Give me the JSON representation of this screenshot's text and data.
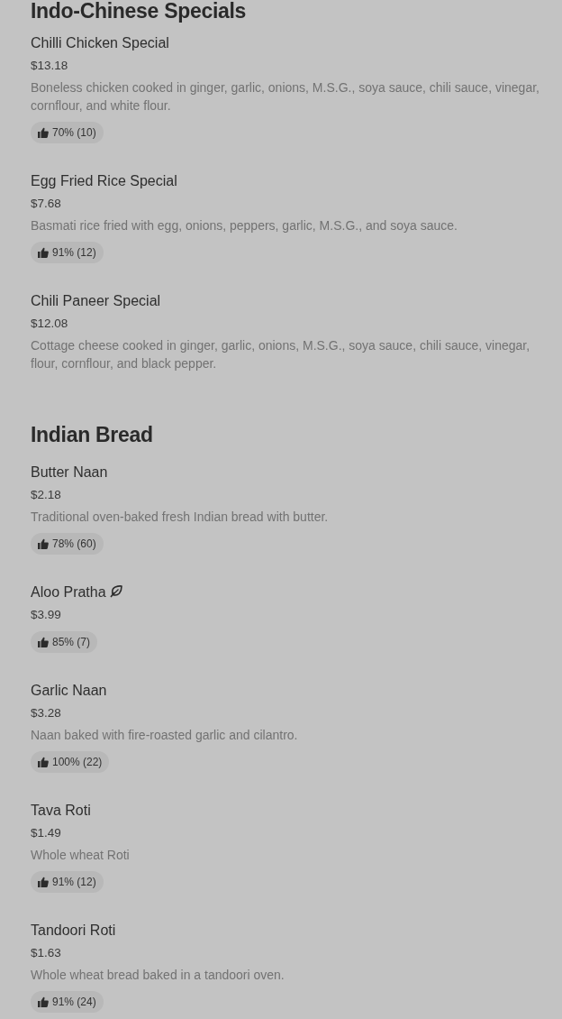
{
  "sections": [
    {
      "title": "Indo-Chinese Specials",
      "items": [
        {
          "name": "Chilli Chicken Special",
          "vegetarian": false,
          "price": "$13.18",
          "description": "Boneless chicken cooked in ginger, garlic, onions, M.S.G., soya sauce, chili sauce, vinegar, cornflour, and white flour.",
          "rating": "70% (10)"
        },
        {
          "name": "Egg Fried Rice Special",
          "vegetarian": false,
          "price": "$7.68",
          "description": "Basmati rice fried with egg, onions, peppers, garlic, M.S.G., and soya sauce.",
          "rating": "91% (12)"
        },
        {
          "name": "Chili Paneer Special",
          "vegetarian": false,
          "price": "$12.08",
          "description": "Cottage cheese cooked in ginger, garlic, onions, M.S.G., soya sauce, chili sauce, vinegar, flour, cornflour, and black pepper."
        }
      ]
    },
    {
      "title": "Indian Bread",
      "items": [
        {
          "name": "Butter Naan",
          "vegetarian": false,
          "price": "$2.18",
          "description": "Traditional oven-baked fresh Indian bread with butter.",
          "rating": "78% (60)"
        },
        {
          "name": "Aloo Pratha",
          "vegetarian": true,
          "price": "$3.99",
          "rating": "85% (7)"
        },
        {
          "name": "Garlic Naan",
          "vegetarian": false,
          "price": "$3.28",
          "description": "Naan baked with fire-roasted garlic and cilantro.",
          "rating": "100% (22)"
        },
        {
          "name": "Tava Roti",
          "vegetarian": false,
          "price": "$1.49",
          "description": "Whole wheat Roti",
          "rating": "91% (12)"
        },
        {
          "name": "Tandoori Roti",
          "vegetarian": false,
          "price": "$1.63",
          "description": "Whole wheat bread baked in a tandoori oven.",
          "rating": "91% (24)"
        }
      ]
    }
  ]
}
